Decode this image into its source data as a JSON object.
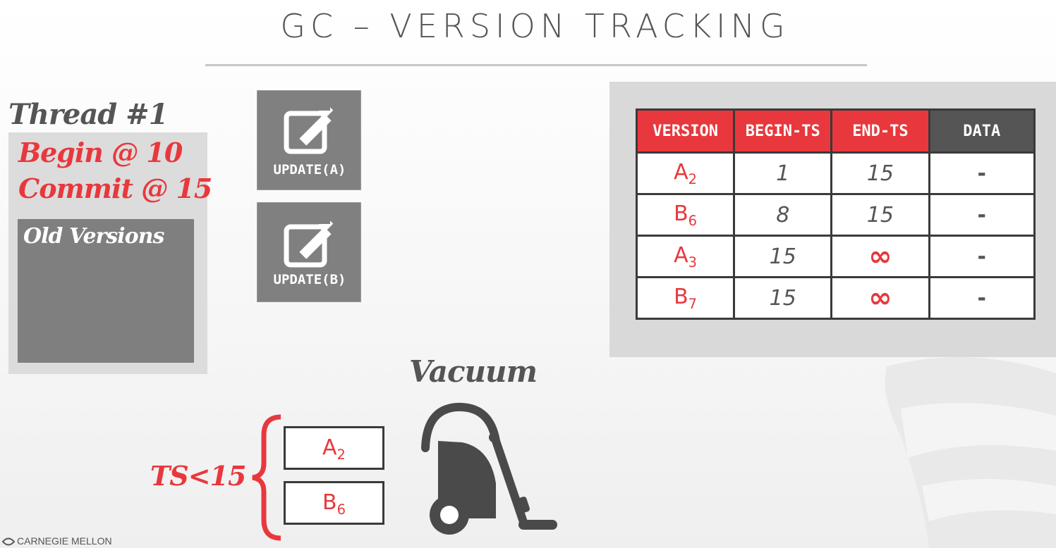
{
  "slide": {
    "title": "GC – VERSION TRACKING",
    "footer": "CARNEGIE MELLON"
  },
  "thread": {
    "label": "Thread #1",
    "begin": "Begin @ 10",
    "commit": "Commit @ 15",
    "old_versions_label": "Old Versions"
  },
  "operations": [
    {
      "label": "UPDATE(A)",
      "icon": "edit-icon"
    },
    {
      "label": "UPDATE(B)",
      "icon": "edit-icon"
    }
  ],
  "table": {
    "headers": [
      "VERSION",
      "BEGIN-TS",
      "END-TS",
      "DATA"
    ],
    "rows": [
      {
        "version": "A",
        "sub": "2",
        "begin": "1",
        "end": "15",
        "data": "-"
      },
      {
        "version": "B",
        "sub": "6",
        "begin": "8",
        "end": "15",
        "data": "-"
      },
      {
        "version": "A",
        "sub": "3",
        "begin": "15",
        "end": "∞",
        "data": "-"
      },
      {
        "version": "B",
        "sub": "7",
        "begin": "15",
        "end": "∞",
        "data": "-"
      }
    ]
  },
  "vacuum": {
    "label": "Vacuum",
    "condition": "TS<15",
    "collected": [
      {
        "version": "A",
        "sub": "2"
      },
      {
        "version": "B",
        "sub": "6"
      }
    ],
    "icon": "vacuum-cleaner-icon"
  },
  "colors": {
    "accent": "#e8383d",
    "dark": "#555555",
    "tile": "#808080"
  }
}
